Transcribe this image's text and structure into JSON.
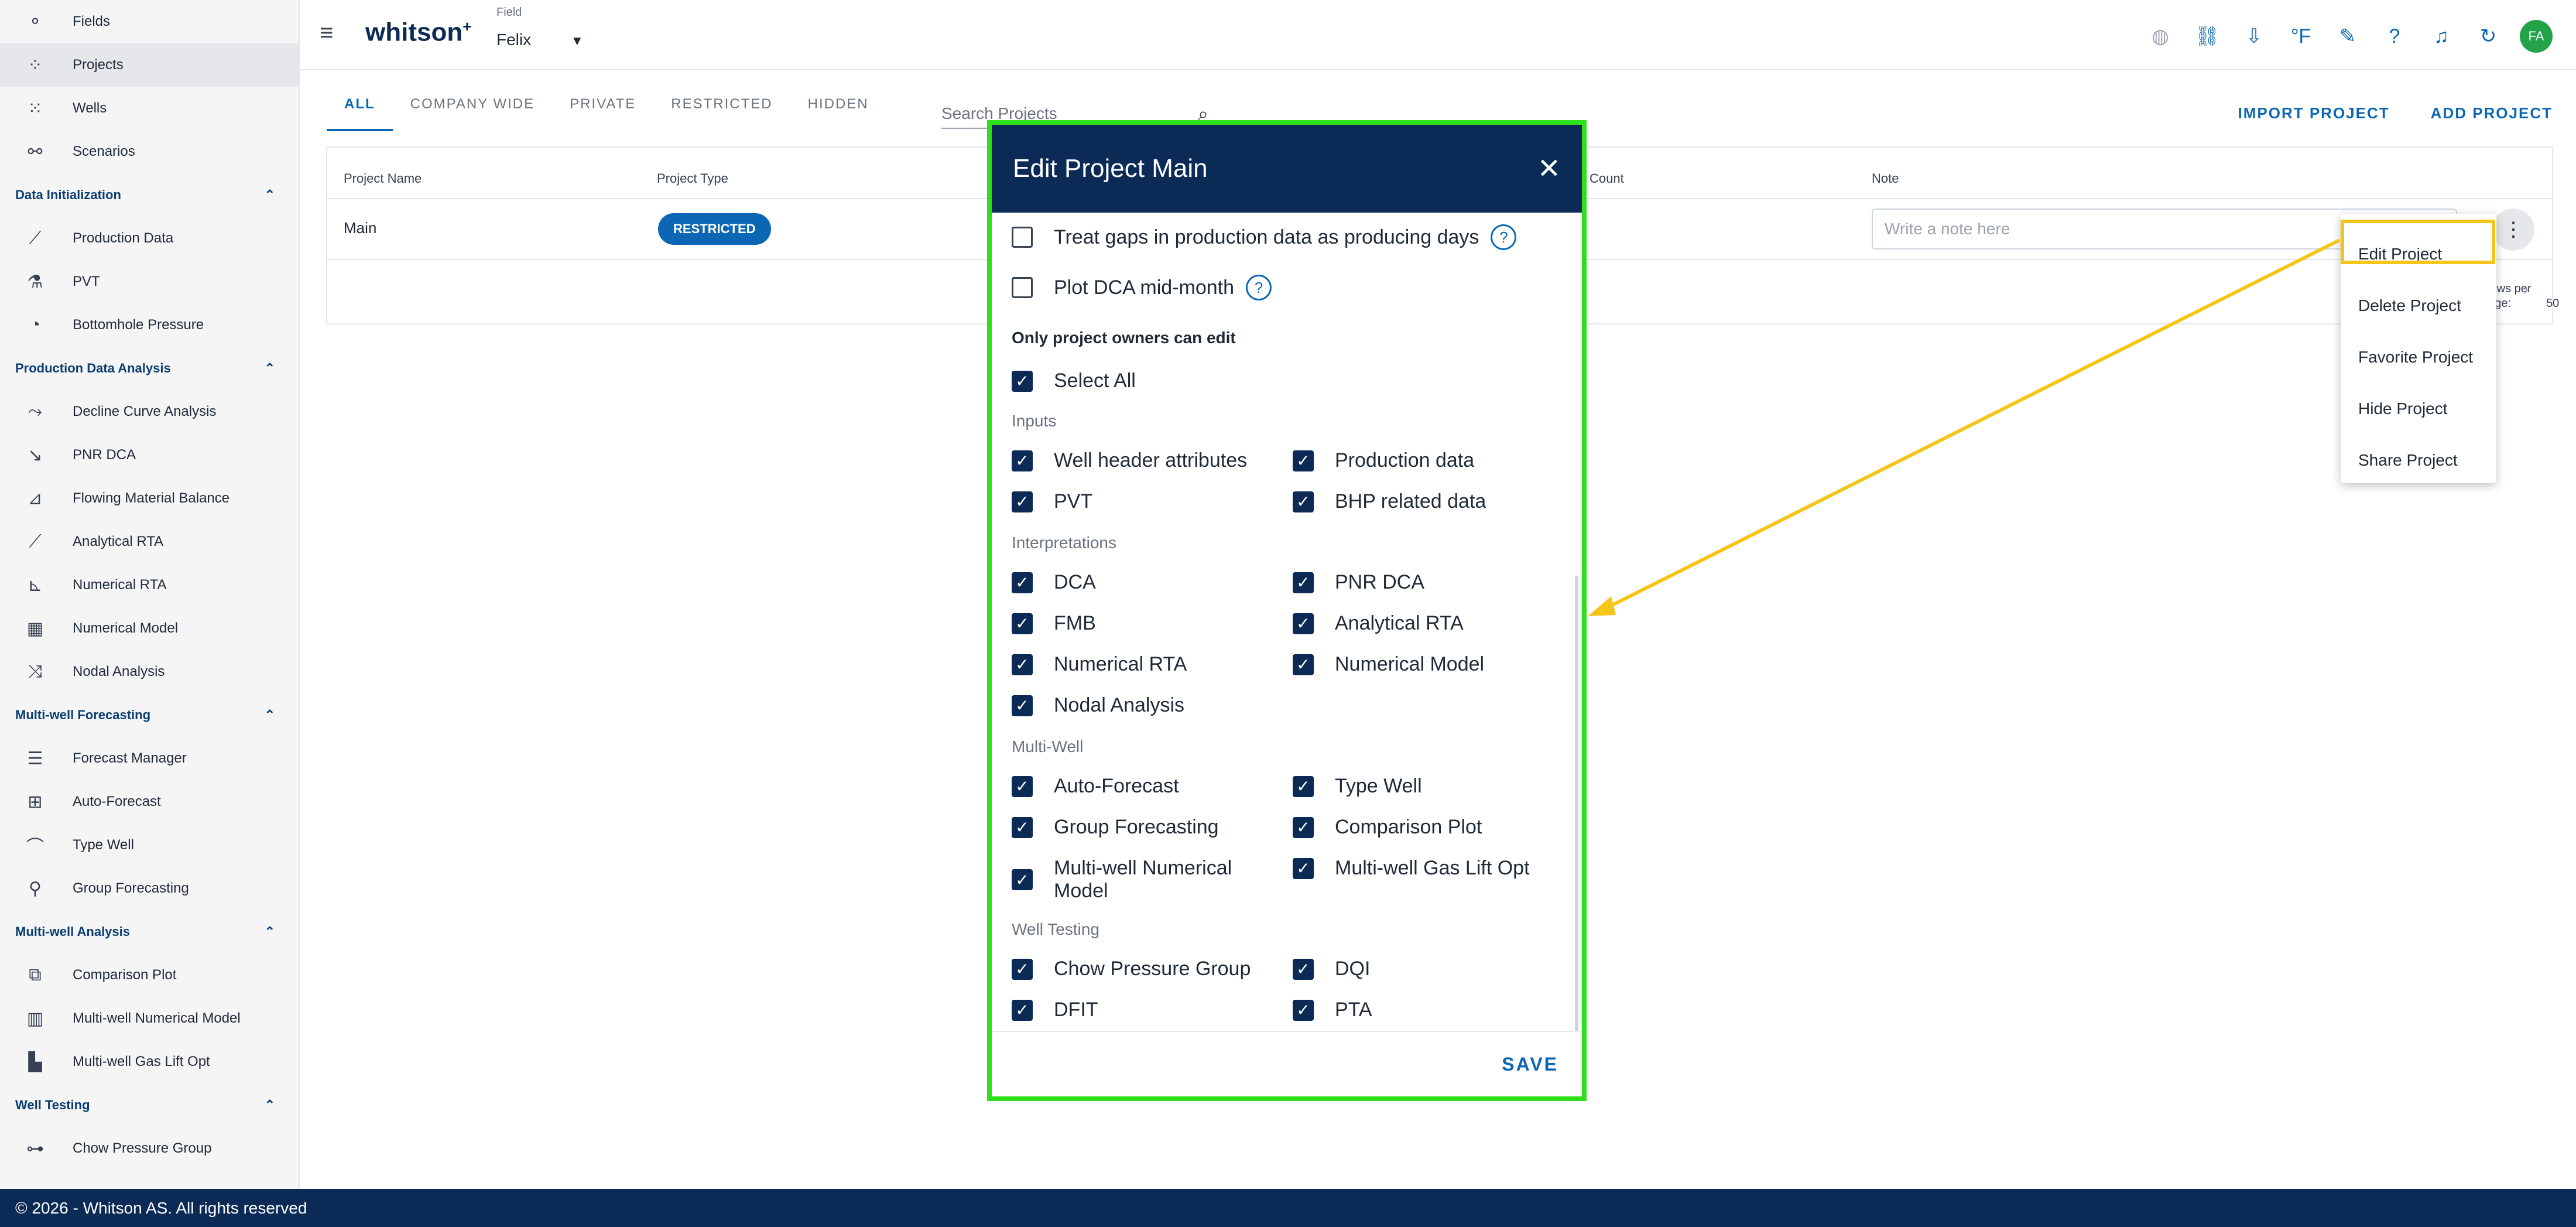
{
  "sidebar": {
    "top": [
      {
        "label": "Fields",
        "icon": "fields-icon"
      },
      {
        "label": "Projects",
        "icon": "projects-icon"
      },
      {
        "label": "Wells",
        "icon": "wells-icon"
      },
      {
        "label": "Scenarios",
        "icon": "scenarios-icon"
      }
    ],
    "sections": [
      {
        "title": "Data Initialization",
        "items": [
          "Production Data",
          "PVT",
          "Bottomhole Pressure"
        ]
      },
      {
        "title": "Production Data Analysis",
        "items": [
          "Decline Curve Analysis",
          "PNR DCA",
          "Flowing Material Balance",
          "Analytical RTA",
          "Numerical RTA",
          "Numerical Model",
          "Nodal Analysis"
        ]
      },
      {
        "title": "Multi-well Forecasting",
        "items": [
          "Forecast Manager",
          "Auto-Forecast",
          "Type Well",
          "Group Forecasting"
        ]
      },
      {
        "title": "Multi-well Analysis",
        "items": [
          "Comparison Plot",
          "Multi-well Numerical Model",
          "Multi-well Gas Lift Opt"
        ]
      },
      {
        "title": "Well Testing",
        "items": [
          "Chow Pressure Group"
        ]
      }
    ]
  },
  "topbar": {
    "brand": "whitson",
    "brand_sup": "+",
    "field_label": "Field",
    "field_value": "Felix",
    "avatar": "FA",
    "unit": "°F"
  },
  "tabs": [
    "ALL",
    "COMPANY WIDE",
    "PRIVATE",
    "RESTRICTED",
    "HIDDEN"
  ],
  "search": {
    "placeholder": "Search Projects"
  },
  "actions": {
    "import": "IMPORT PROJECT",
    "add": "ADD PROJECT"
  },
  "table": {
    "headers": {
      "name": "Project Name",
      "type": "Project Type",
      "count": "Count",
      "note": "Note"
    },
    "row": {
      "name": "Main",
      "type": "RESTRICTED",
      "note_placeholder": "Write a note here"
    },
    "rows_per_page_label": "Rows per page:",
    "rows_per_page": "50"
  },
  "menu": [
    "Edit Project",
    "Delete Project",
    "Favorite Project",
    "Hide Project",
    "Share Project"
  ],
  "dialog": {
    "title": "Edit Project Main",
    "opt_gaps": "Treat gaps in production data as producing days",
    "opt_mid": "Plot DCA mid-month",
    "owners_label": "Only project owners can edit",
    "select_all": "Select All",
    "groups": {
      "inputs": "Inputs",
      "interp": "Interpretations",
      "multi": "Multi-Well",
      "testing": "Well Testing"
    },
    "items": {
      "whattr": "Well header attributes",
      "prod": "Production data",
      "pvt": "PVT",
      "bhp": "BHP related data",
      "dca": "DCA",
      "pnr": "PNR DCA",
      "fmb": "FMB",
      "arta": "Analytical RTA",
      "nrta": "Numerical RTA",
      "nmodel": "Numerical Model",
      "nodal": "Nodal Analysis",
      "af": "Auto-Forecast",
      "tw": "Type Well",
      "gf": "Group Forecasting",
      "cp": "Comparison Plot",
      "mwnm": "Multi-well Numerical Model",
      "mwgl": "Multi-well Gas Lift Opt",
      "chow": "Chow Pressure Group",
      "dqi": "DQI",
      "dfit": "DFIT",
      "pta": "PTA"
    },
    "save": "SAVE"
  },
  "footer": "© 2026 - Whitson AS. All rights reserved"
}
